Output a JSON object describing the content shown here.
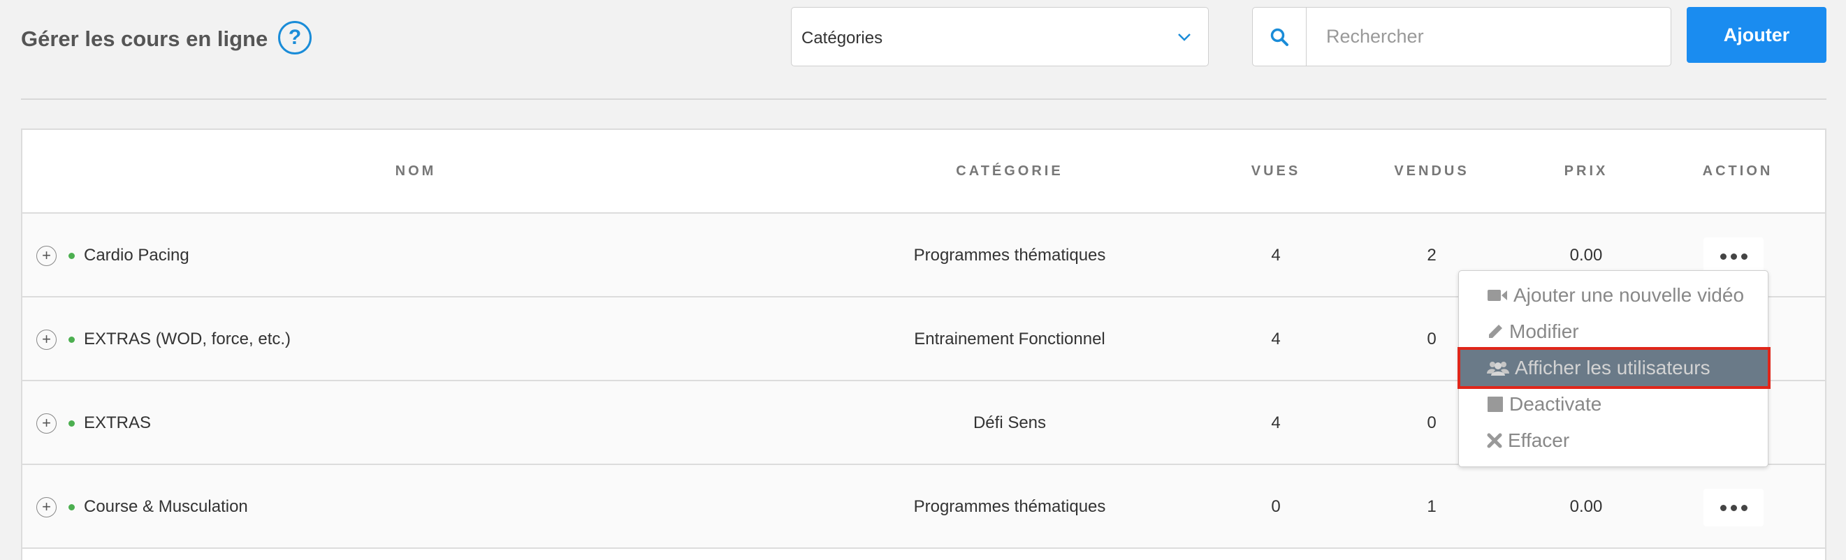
{
  "header": {
    "title": "Gérer les cours en ligne",
    "help": "?",
    "category_select": "Catégories",
    "search_placeholder": "Rechercher",
    "add_label": "Ajouter"
  },
  "table": {
    "columns": [
      "NOM",
      "CATÉGORIE",
      "VUES",
      "VENDUS",
      "PRIX",
      "ACTION"
    ],
    "rows": [
      {
        "name": "Cardio Pacing",
        "category": "Programmes thématiques",
        "views": "4",
        "sold": "2",
        "price": "0.00"
      },
      {
        "name": "EXTRAS (WOD, force, etc.)",
        "category": "Entrainement Fonctionnel",
        "views": "4",
        "sold": "0",
        "price": ""
      },
      {
        "name": "EXTRAS",
        "category": "Défi Sens",
        "views": "4",
        "sold": "0",
        "price": ""
      },
      {
        "name": "Course & Musculation",
        "category": "Programmes thématiques",
        "views": "0",
        "sold": "1",
        "price": "0.00"
      }
    ],
    "expand_symbol": "+"
  },
  "action_menu": {
    "items": [
      {
        "label": "Ajouter une nouvelle vidéo",
        "icon": "video-camera-icon"
      },
      {
        "label": "Modifier",
        "icon": "pencil-icon"
      },
      {
        "label": "Afficher les utilisateurs",
        "icon": "users-icon"
      },
      {
        "label": "Deactivate",
        "icon": "square-icon"
      },
      {
        "label": "Effacer",
        "icon": "close-icon"
      }
    ],
    "highlighted_item": "Afficher les utilisateurs"
  },
  "colors": {
    "accent": "#1a8cf0",
    "status_dot": "#4caf50",
    "highlight_bg": "#6a7a88",
    "highlight_border": "#e0261a"
  }
}
